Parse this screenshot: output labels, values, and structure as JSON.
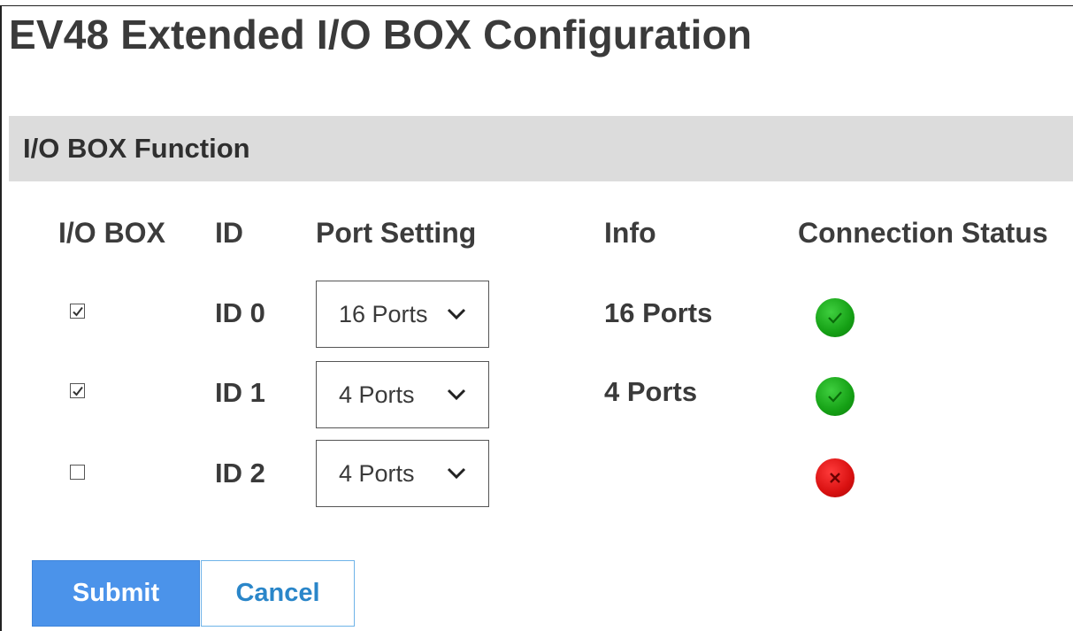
{
  "page": {
    "title": "EV48 Extended I/O BOX Configuration"
  },
  "section": {
    "title": "I/O BOX Function"
  },
  "columns": {
    "io_box": "I/O BOX",
    "id": "ID",
    "port_setting": "Port Setting",
    "info": "Info",
    "connection_status": "Connection Status"
  },
  "rows": [
    {
      "checked": true,
      "id": "ID 0",
      "port_setting": "16 Ports",
      "info": "16 Ports",
      "status": "connected",
      "status_icon": "check-circle-icon"
    },
    {
      "checked": true,
      "id": "ID 1",
      "port_setting": "4 Ports",
      "info": "4 Ports",
      "status": "connected",
      "status_icon": "check-circle-icon"
    },
    {
      "checked": false,
      "id": "ID 2",
      "port_setting": "4 Ports",
      "info": "",
      "status": "disconnected",
      "status_icon": "x-circle-icon"
    }
  ],
  "buttons": {
    "submit": "Submit",
    "cancel": "Cancel"
  },
  "colors": {
    "section_bar": "#dcdcdc",
    "submit_bg": "#4b93ea",
    "cancel_text": "#2a86c9",
    "status_ok": "#15a015",
    "status_error": "#d81010"
  }
}
